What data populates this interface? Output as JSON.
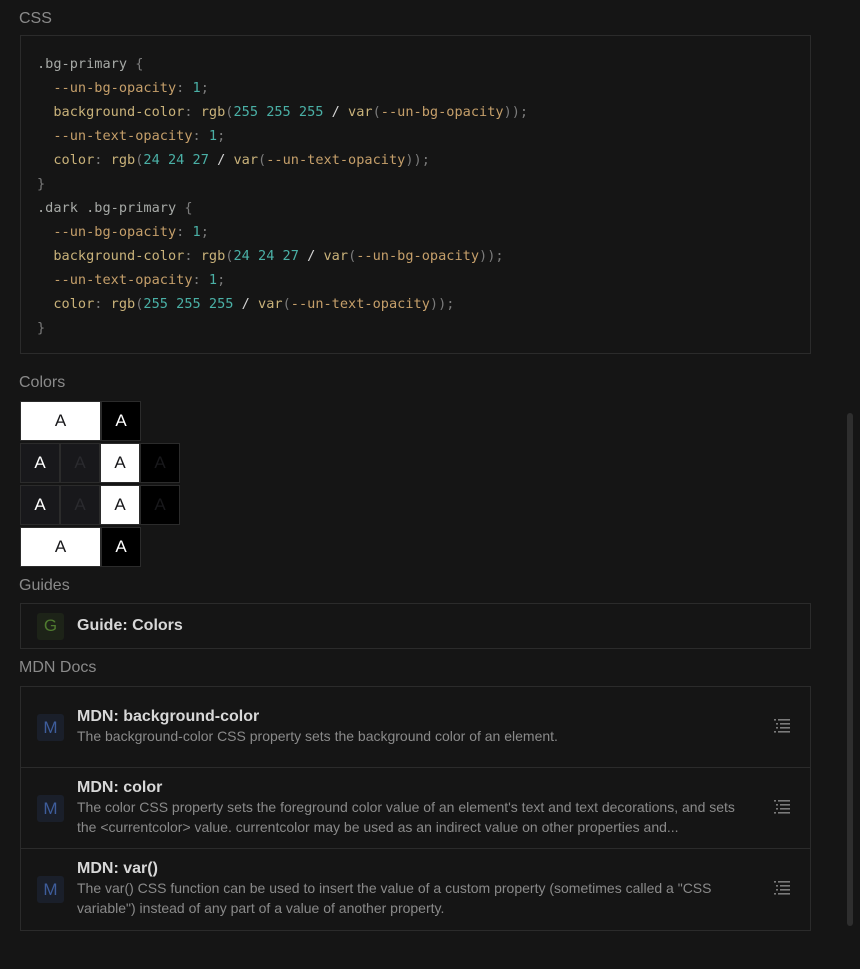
{
  "css_section": {
    "title": "CSS",
    "lines": [
      [
        {
          "t": ".bg-primary ",
          "c": "c-sel"
        },
        {
          "t": "{",
          "c": "c-punc"
        }
      ],
      [
        {
          "t": "  --un-bg-opacity",
          "c": "c-var"
        },
        {
          "t": ": ",
          "c": "c-punc"
        },
        {
          "t": "1",
          "c": "c-num"
        },
        {
          "t": ";",
          "c": "c-punc"
        }
      ],
      [
        {
          "t": "  background-color",
          "c": "c-prop"
        },
        {
          "t": ": ",
          "c": "c-punc"
        },
        {
          "t": "rgb",
          "c": "c-fn"
        },
        {
          "t": "(",
          "c": "c-punc"
        },
        {
          "t": "255 255 255",
          "c": "c-num"
        },
        {
          "t": " / ",
          "c": "c-plain"
        },
        {
          "t": "var",
          "c": "c-fn"
        },
        {
          "t": "(",
          "c": "c-punc"
        },
        {
          "t": "--un-bg-opacity",
          "c": "c-var"
        },
        {
          "t": "));",
          "c": "c-punc"
        }
      ],
      [
        {
          "t": "  --un-text-opacity",
          "c": "c-var"
        },
        {
          "t": ": ",
          "c": "c-punc"
        },
        {
          "t": "1",
          "c": "c-num"
        },
        {
          "t": ";",
          "c": "c-punc"
        }
      ],
      [
        {
          "t": "  color",
          "c": "c-prop"
        },
        {
          "t": ": ",
          "c": "c-punc"
        },
        {
          "t": "rgb",
          "c": "c-fn"
        },
        {
          "t": "(",
          "c": "c-punc"
        },
        {
          "t": "24 24 27",
          "c": "c-num"
        },
        {
          "t": " / ",
          "c": "c-plain"
        },
        {
          "t": "var",
          "c": "c-fn"
        },
        {
          "t": "(",
          "c": "c-punc"
        },
        {
          "t": "--un-text-opacity",
          "c": "c-var"
        },
        {
          "t": "));",
          "c": "c-punc"
        }
      ],
      [
        {
          "t": "}",
          "c": "c-punc"
        }
      ],
      [
        {
          "t": ".dark .bg-primary ",
          "c": "c-sel"
        },
        {
          "t": "{",
          "c": "c-punc"
        }
      ],
      [
        {
          "t": "  --un-bg-opacity",
          "c": "c-var"
        },
        {
          "t": ": ",
          "c": "c-punc"
        },
        {
          "t": "1",
          "c": "c-num"
        },
        {
          "t": ";",
          "c": "c-punc"
        }
      ],
      [
        {
          "t": "  background-color",
          "c": "c-prop"
        },
        {
          "t": ": ",
          "c": "c-punc"
        },
        {
          "t": "rgb",
          "c": "c-fn"
        },
        {
          "t": "(",
          "c": "c-punc"
        },
        {
          "t": "24 24 27",
          "c": "c-num"
        },
        {
          "t": " / ",
          "c": "c-plain"
        },
        {
          "t": "var",
          "c": "c-fn"
        },
        {
          "t": "(",
          "c": "c-punc"
        },
        {
          "t": "--un-bg-opacity",
          "c": "c-var"
        },
        {
          "t": "));",
          "c": "c-punc"
        }
      ],
      [
        {
          "t": "  --un-text-opacity",
          "c": "c-var"
        },
        {
          "t": ": ",
          "c": "c-punc"
        },
        {
          "t": "1",
          "c": "c-num"
        },
        {
          "t": ";",
          "c": "c-punc"
        }
      ],
      [
        {
          "t": "  color",
          "c": "c-prop"
        },
        {
          "t": ": ",
          "c": "c-punc"
        },
        {
          "t": "rgb",
          "c": "c-fn"
        },
        {
          "t": "(",
          "c": "c-punc"
        },
        {
          "t": "255 255 255",
          "c": "c-num"
        },
        {
          "t": " / ",
          "c": "c-plain"
        },
        {
          "t": "var",
          "c": "c-fn"
        },
        {
          "t": "(",
          "c": "c-punc"
        },
        {
          "t": "--un-text-opacity",
          "c": "c-var"
        },
        {
          "t": "));",
          "c": "c-punc"
        }
      ],
      [
        {
          "t": "}",
          "c": "c-punc"
        }
      ]
    ]
  },
  "colors_section": {
    "title": "Colors",
    "rows": [
      [
        {
          "label": "A",
          "bg": "#ffffff",
          "fg": "#18181b",
          "span": 2
        },
        {
          "label": "A",
          "bg": "#000000",
          "fg": "#ffffff",
          "span": 1
        }
      ],
      [
        {
          "label": "A",
          "bg": "#18181b",
          "fg": "#ffffff",
          "span": 1
        },
        {
          "label": "A",
          "bg": "#18181b",
          "fg": "#2a2a2e",
          "span": 1
        },
        {
          "label": "A",
          "bg": "#ffffff",
          "fg": "#18181b",
          "span": 1
        },
        {
          "label": "A",
          "bg": "#000000",
          "fg": "#18181b",
          "span": 1
        }
      ],
      [
        {
          "label": "A",
          "bg": "#18181b",
          "fg": "#ffffff",
          "span": 1
        },
        {
          "label": "A",
          "bg": "#18181b",
          "fg": "#2a2a2e",
          "span": 1
        },
        {
          "label": "A",
          "bg": "#ffffff",
          "fg": "#18181b",
          "span": 1
        },
        {
          "label": "A",
          "bg": "#000000",
          "fg": "#18181b",
          "span": 1
        }
      ],
      [
        {
          "label": "A",
          "bg": "#ffffff",
          "fg": "#18181b",
          "span": 2
        },
        {
          "label": "A",
          "bg": "#000000",
          "fg": "#ffffff",
          "span": 1
        }
      ]
    ]
  },
  "guides_section": {
    "title": "Guides",
    "items": [
      {
        "badge": "G",
        "label": "Guide: Colors"
      }
    ]
  },
  "mdn_section": {
    "title": "MDN Docs",
    "items": [
      {
        "badge": "M",
        "title": "MDN: background-color",
        "description": "The background-color CSS property sets the background color of an element.",
        "icon": "list-icon"
      },
      {
        "badge": "M",
        "title": "MDN: color",
        "description": "The color CSS property sets the foreground color value of an element's text and text decorations, and sets the <currentcolor> value. currentcolor may be used as an indirect value on other properties and...",
        "icon": "list-icon"
      },
      {
        "badge": "M",
        "title": "MDN: var()",
        "description": "The var() CSS function can be used to insert the value of a custom property (sometimes called a \"CSS variable\") instead of any part of a value of another property.",
        "icon": "list-icon"
      }
    ]
  },
  "colors": {
    "background": "#151515",
    "border": "#2b2b2b",
    "muted_text": "#8a8a8a",
    "guide_badge": "#4f7a2f",
    "mdn_badge": "#3e5d9c"
  }
}
